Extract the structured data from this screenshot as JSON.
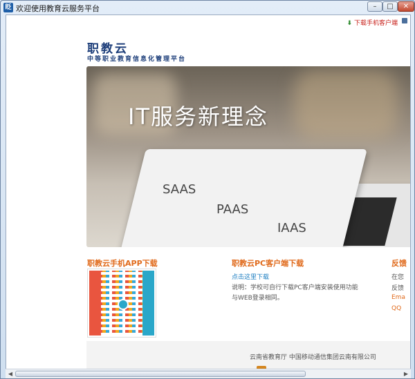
{
  "window": {
    "title": "欢迎使用教育云服务平台",
    "icon_label": "眨",
    "buttons": {
      "minimize": "–",
      "maximize": "□",
      "close": "✕"
    }
  },
  "topbar": {
    "download_client": "下载手机客户端",
    "download_icon": "download-arrow-icon",
    "pin_icon": "pin-icon"
  },
  "brand": {
    "logo": "职教云",
    "tagline": "中等职业教育信息化管理平台"
  },
  "banner": {
    "headline": "IT服务新理念",
    "items": [
      "SAAS",
      "PAAS",
      "IAAS"
    ]
  },
  "sections": {
    "app": {
      "title": "职教云手机APP下载"
    },
    "pc": {
      "title": "职教云PC客户端下载",
      "link": "点击这里下载",
      "desc": "说明：学校可自行下载PC客户端安装使用功能与WEB登录相同。"
    },
    "feedback": {
      "title": "反馈",
      "line1": "在您",
      "line2": "反馈",
      "line3": "Ema",
      "line4": "QQ"
    }
  },
  "footer": {
    "orgs": "云南省教育厅   中国移动通信集团云南有限公司"
  },
  "scrollbar": {
    "left": "◀",
    "right": "▶"
  },
  "colors": {
    "accent": "#e06a1b",
    "brand": "#1d3e7a",
    "link": "#1b7dc0",
    "download": "#c8211b"
  }
}
